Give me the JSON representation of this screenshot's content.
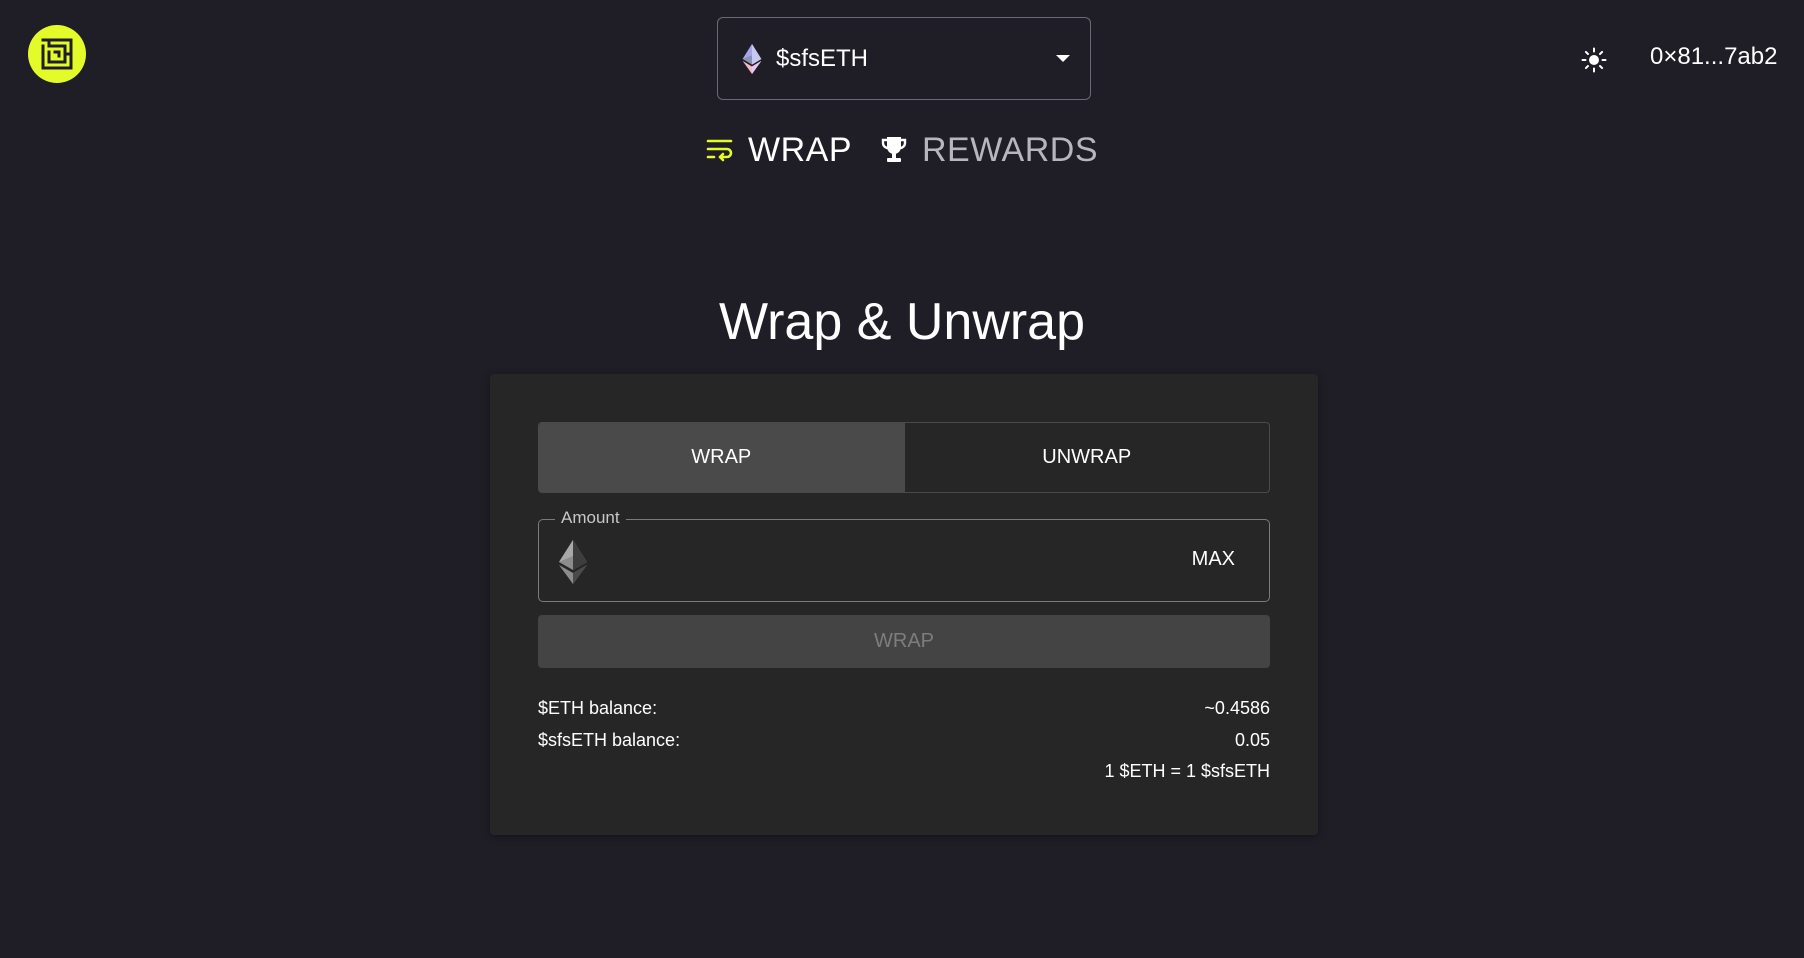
{
  "header": {
    "logo_alt": "",
    "token_selector": {
      "label": "$sfsETH",
      "icon": "ethereum-icon"
    },
    "wallet_address": "0×81...7ab2",
    "theme_icon": "sun-icon"
  },
  "nav": {
    "tabs": [
      {
        "label": "WRAP",
        "icon": "wrap-lines-icon",
        "active": true
      },
      {
        "label": "REWARDS",
        "icon": "trophy-icon",
        "active": false
      }
    ]
  },
  "main": {
    "title": "Wrap & Unwrap",
    "mode_toggle": [
      {
        "label": "WRAP",
        "selected": true
      },
      {
        "label": "UNWRAP",
        "selected": false
      }
    ],
    "amount": {
      "legend": "Amount",
      "value": "",
      "placeholder": "",
      "max_label": "MAX",
      "icon": "ethereum-icon"
    },
    "submit_label": "WRAP",
    "balances": {
      "eth_label": "$ETH balance:",
      "eth_value": "~0.4586",
      "sfseth_label": "$sfsETH balance:",
      "sfseth_value": "0.05",
      "rate": "1 $ETH = 1 $sfsETH"
    }
  },
  "colors": {
    "background": "#1f1d26",
    "card": "#262626",
    "accent": "#e4fb2a",
    "selected_toggle": "#4a4a4a",
    "disabled_button": "#444444"
  }
}
